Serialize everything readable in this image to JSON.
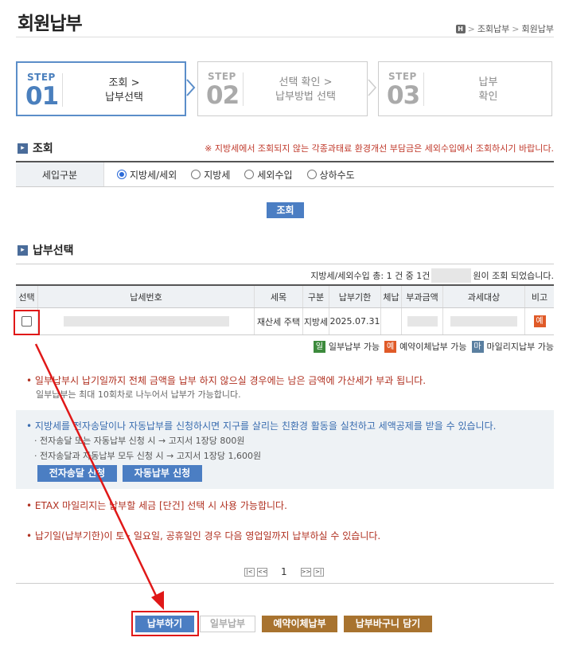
{
  "page": {
    "title": "회원납부"
  },
  "breadcrumb": {
    "home_icon": "home-icon",
    "home_label": "H",
    "item1": "조회납부",
    "item2": "회원납부",
    "sep": ">"
  },
  "steps": [
    {
      "label": "STEP",
      "num": "01",
      "line1": "조회 >",
      "line2": "납부선택"
    },
    {
      "label": "STEP",
      "num": "02",
      "line1": "선택 확인 >",
      "line2": "납부방법 선택"
    },
    {
      "label": "STEP",
      "num": "03",
      "line1": "납부",
      "line2": "확인"
    }
  ],
  "search": {
    "section_title": "조회",
    "notice": "※ 지방세에서 조회되지 않는 각종과태료 환경개선 부담금은 세외수입에서 조회하시기 바랍니다.",
    "row_label": "세입구분",
    "options": [
      "지방세/세외",
      "지방세",
      "세외수입",
      "상하수도"
    ],
    "selected": "지방세/세외",
    "button": "조회"
  },
  "results": {
    "section_title": "납부선택",
    "count_prefix": "지방세/세외수입 총: 1 건 중 1건",
    "count_suffix": "원이 조회 되었습니다.",
    "headers": [
      "선택",
      "납세번호",
      "세목",
      "구분",
      "납부기한",
      "체납",
      "부과금액",
      "과세대상",
      "비고"
    ],
    "rows": [
      {
        "tax_item": "재산세 주택",
        "category": "지방세",
        "due_date": "2025.07.31",
        "delinquent": "",
        "note_badge": "예"
      }
    ]
  },
  "legend": [
    {
      "badge": "일",
      "label": "일부납부 가능",
      "color": "#3c8a3c"
    },
    {
      "badge": "예",
      "label": "예약이체납부 가능",
      "color": "#e05a28"
    },
    {
      "badge": "마",
      "label": "마일리지납부 가능",
      "color": "#5a7fa0"
    }
  ],
  "notices": {
    "partial_main": "일부납부시 납기일까지 전체 금액을 납부 하지 않으실 경우에는 남은 금액에 가산세가 부과 됩니다.",
    "partial_sub": "일부납부는 최대 10회차로 나누어서 납부가 가능합니다.",
    "eco_main": "지방세를 전자송달이나 자동납부를 신청하시면 지구를 살리는 친환경 활동을 실천하고 세액공제를 받을 수 있습니다.",
    "eco_sub1": "· 전자송달 또는 자동납부 신청 시 → 고지서 1장당 800원",
    "eco_sub2": "· 전자송달과 자동납부 모두 신청 시 → 고지서 1장당 1,600원",
    "eco_btn1": "전자송달 신청",
    "eco_btn2": "자동납부 신청",
    "mileage": "ETAX 마일리지는 납부할 세금 [단건] 선택 시 사용 가능합니다.",
    "holiday": "납기일(납부기한)이 토 · 일요일, 공휴일인 경우 다음 영업일까지 납부하실 수 있습니다."
  },
  "pagination": {
    "first": "|<",
    "prev": "<<",
    "current": "1",
    "next": ">>",
    "last": ">|"
  },
  "actions": {
    "pay": "납부하기",
    "partial": "일부납부",
    "reserve": "예약이체납부",
    "cart": "납부바구니 담기"
  },
  "colors": {
    "accent": "#4b7ec3",
    "brown": "#a8732f",
    "annotation_red": "#e01818"
  }
}
